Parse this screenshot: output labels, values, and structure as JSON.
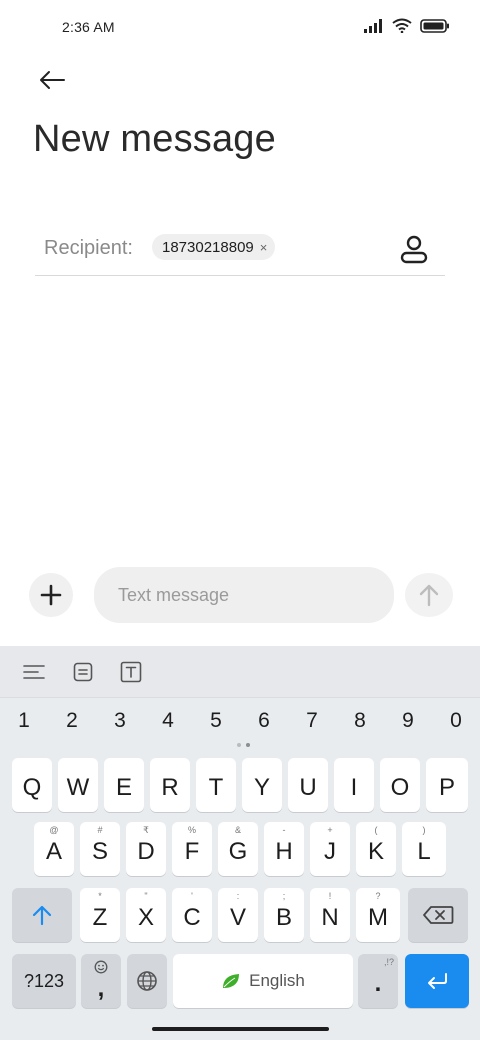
{
  "status_bar": {
    "time": "2:36 AM"
  },
  "header": {
    "title": "New message"
  },
  "recipient": {
    "label": "Recipient:",
    "chip_value": "18730218809",
    "chip_remove": "×"
  },
  "compose": {
    "placeholder": "Text message"
  },
  "keyboard": {
    "numbers": [
      "1",
      "2",
      "3",
      "4",
      "5",
      "6",
      "7",
      "8",
      "9",
      "0"
    ],
    "row1": [
      {
        "key": "Q"
      },
      {
        "key": "W"
      },
      {
        "key": "E"
      },
      {
        "key": "R"
      },
      {
        "key": "T"
      },
      {
        "key": "Y"
      },
      {
        "key": "U"
      },
      {
        "key": "I"
      },
      {
        "key": "O"
      },
      {
        "key": "P"
      }
    ],
    "row2": [
      {
        "key": "A",
        "sub": "@"
      },
      {
        "key": "S",
        "sub": "#"
      },
      {
        "key": "D",
        "sub": "₹"
      },
      {
        "key": "F",
        "sub": "%"
      },
      {
        "key": "G",
        "sub": "&"
      },
      {
        "key": "H",
        "sub": "-"
      },
      {
        "key": "J",
        "sub": "+"
      },
      {
        "key": "K",
        "sub": "("
      },
      {
        "key": "L",
        "sub": ")"
      }
    ],
    "row3": [
      {
        "key": "Z",
        "sub": "*"
      },
      {
        "key": "X",
        "sub": "\""
      },
      {
        "key": "C",
        "sub": "'"
      },
      {
        "key": "V",
        "sub": ":"
      },
      {
        "key": "B",
        "sub": ";"
      },
      {
        "key": "N",
        "sub": "!"
      },
      {
        "key": "M",
        "sub": "?"
      }
    ],
    "symbols_key": "?123",
    "emoji_comma": ",",
    "space_label": "English",
    "period_key": ".",
    "period_sub": ",!?"
  },
  "colors": {
    "enter_key": "#1a8cf0",
    "shift_arrow": "#1a8cf0",
    "leaf": "#3fae2a"
  },
  "icons": [
    "back-arrow-icon",
    "contact-icon",
    "plus-icon",
    "send-arrow-icon",
    "menu-lines-icon",
    "clipboard-icon",
    "text-box-icon",
    "shift-icon",
    "backspace-icon",
    "emoji-icon",
    "globe-icon",
    "leaf-icon",
    "enter-icon"
  ]
}
